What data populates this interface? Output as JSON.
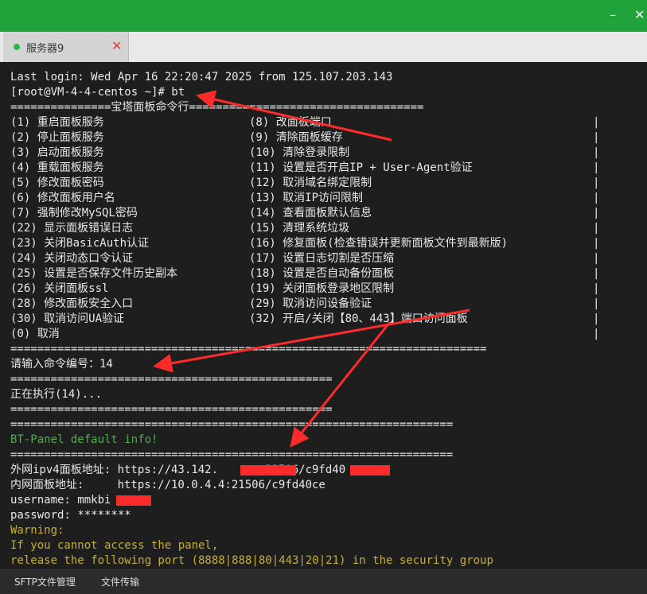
{
  "window": {
    "minimize_glyph": "–",
    "close_glyph": "✕"
  },
  "tab": {
    "label": "服务器9",
    "close_glyph": "✕"
  },
  "terminal": {
    "login": "Last login: Wed Apr 16 22:20:47 2025 from 125.107.203.143",
    "prompt": "[root@VM-4-4-centos ~]# bt",
    "menu_header": "===============宝塔面板命令行===================================",
    "menu_left": [
      "(1) 重启面板服务",
      "(2) 停止面板服务",
      "(3) 启动面板服务",
      "(4) 重载面板服务",
      "(5) 修改面板密码",
      "(6) 修改面板用户名",
      "(7) 强制修改MySQL密码",
      "(22) 显示面板错误日志",
      "(23) 关闭BasicAuth认证",
      "(24) 关闭动态口令认证",
      "(25) 设置是否保存文件历史副本",
      "(26) 关闭面板ssl",
      "(28) 修改面板安全入口",
      "(30) 取消访问UA验证",
      "(0) 取消"
    ],
    "menu_right": [
      "(8) 改面板端口",
      "(9) 清除面板缓存",
      "(10) 清除登录限制",
      "(11) 设置是否开启IP + User-Agent验证",
      "(12) 取消域名绑定限制",
      "(13) 取消IP访问限制",
      "(14) 查看面板默认信息",
      "(15) 清理系统垃圾",
      "(16) 修复面板(检查错误并更新面板文件到最新版)",
      "(17) 设置日志切割是否压缩",
      "(18) 设置是否自动备份面板",
      "(19) 关闭面板登录地区限制",
      "(29) 取消访问设备验证",
      "(32) 开启/关闭【80、443】端口访问面板",
      ""
    ],
    "menu_bar_glyph": "|",
    "menu_footer": "=======================================================================",
    "input_prompt": "请输入命令编号：14",
    "sep_short": "================================================",
    "executing": "正在执行(14)...",
    "sep_long": "==================================================================",
    "bt_info": "BT-Panel default info!",
    "external_addr": "外网ipv4面板地址: https://43.142.   .  :21506/c9fd40",
    "internal_addr": "内网面板地址:     https://10.0.4.4:21506/c9fd40ce",
    "username": "username: mmkbi",
    "password": "password: ********",
    "warning": "Warning:",
    "warning_line1": "If you cannot access the panel,",
    "warning_line2": "release the following port (8888|888|80|443|20|21) in the security group"
  },
  "statusbar": {
    "sftp": "SFTP文件管理",
    "transfer": "文件传输"
  },
  "colors": {
    "topbar": "#1fa33a",
    "terminal_bg": "#1e1e1e",
    "arrow": "#ff2a2a",
    "info_green": "#4caf50",
    "warning_yellow": "#c8b02e"
  }
}
